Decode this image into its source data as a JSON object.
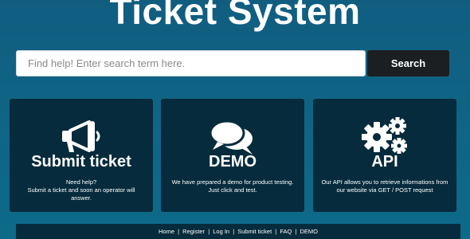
{
  "header": {
    "title": "Ticket System"
  },
  "search": {
    "placeholder": "Find help! Enter search term here.",
    "button_label": "Search"
  },
  "cards": [
    {
      "icon": "megaphone-icon",
      "title": "Submit ticket",
      "desc_line1": "Need help?",
      "desc_line2": "Submit a ticket and soon an operator will answer."
    },
    {
      "icon": "chat-bubbles-icon",
      "title": "DEMO",
      "desc_line1": "We have prepared a demo for product testing.",
      "desc_line2": "Just click and test."
    },
    {
      "icon": "gears-icon",
      "title": "API",
      "desc_line1": "Our API allows you to retrieve informations from our website via GET / POST request",
      "desc_line2": ""
    }
  ],
  "footer": {
    "links": [
      "Home",
      "Register",
      "Log In",
      "Submit ticket",
      "FAQ",
      "DEMO"
    ],
    "separator": "|"
  },
  "colors": {
    "background": "#0f6585",
    "card": "#052b3c",
    "button": "#1b1f22",
    "text": "#ffffff"
  }
}
